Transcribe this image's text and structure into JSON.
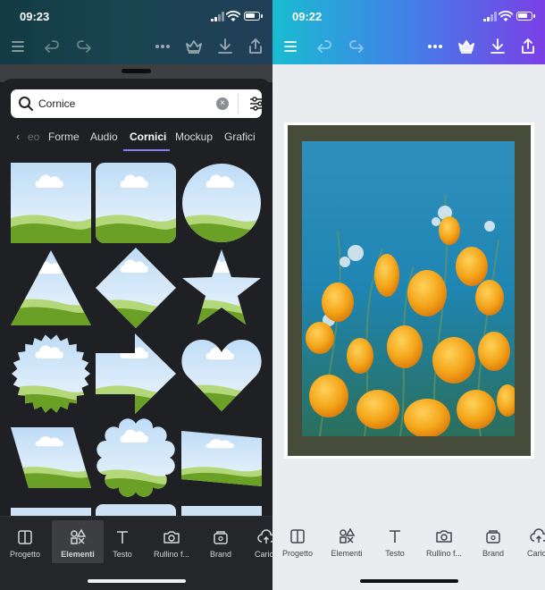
{
  "left": {
    "status_time": "09:23",
    "search": {
      "value": "Cornice"
    },
    "tabs": {
      "partial_prev": "eo",
      "items": [
        "Forme",
        "Audio",
        "Cornici",
        "Mockup",
        "Grafici"
      ],
      "active": "Cornici"
    },
    "frame_shapes": [
      "square",
      "rounded-square",
      "circle",
      "triangle",
      "diamond",
      "star",
      "badge",
      "arrow",
      "heart",
      "parallelogram",
      "scalloped-circle",
      "skewed-rectangle"
    ],
    "bottom_nav": [
      "Progetto",
      "Elementi",
      "Testo",
      "Rullino f...",
      "Brand",
      "Carica"
    ],
    "bottom_nav_selected": "Elementi"
  },
  "right": {
    "status_time": "09:22",
    "bottom_nav": [
      "Progetto",
      "Elementi",
      "Testo",
      "Rullino f...",
      "Brand",
      "Carica"
    ]
  },
  "colors": {
    "panel_bg": "#1f2023",
    "accent_underline": "#8b7cf6",
    "frame_border": "#464c39",
    "canvas_bg": "#ebecf0",
    "sky": "#dcebfa",
    "grass": "#6aa026"
  },
  "icons": {
    "toolbar": [
      "menu-icon",
      "undo-icon",
      "redo-icon",
      "more-icon",
      "crown-icon",
      "download-icon",
      "share-icon"
    ],
    "nav": [
      "layout-icon",
      "elements-icon",
      "text-icon",
      "camera-icon",
      "brand-icon",
      "upload-icon"
    ]
  }
}
